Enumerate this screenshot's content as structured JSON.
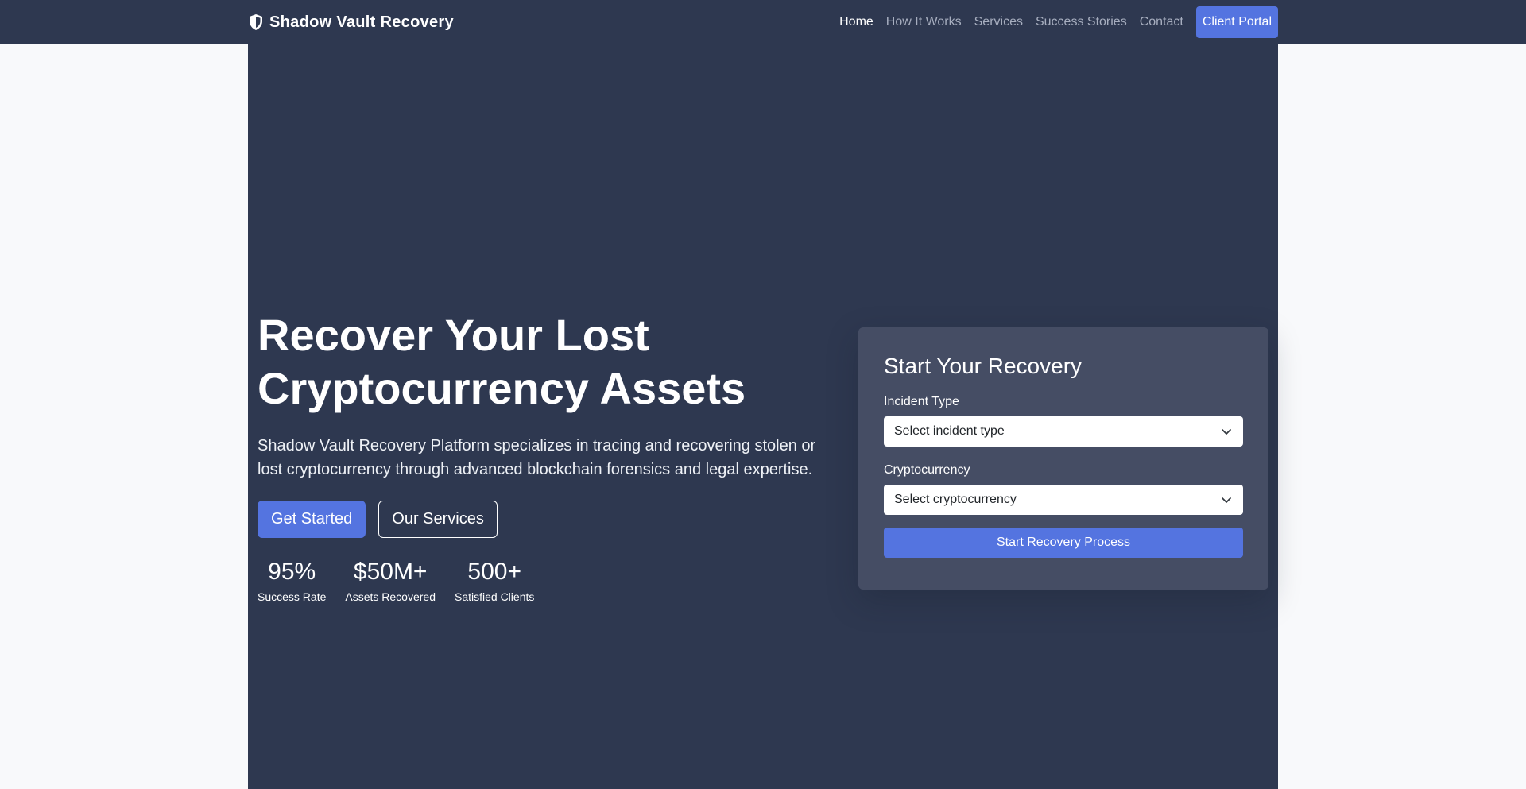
{
  "brand": {
    "name": "Shadow Vault Recovery",
    "icon": "shield-icon"
  },
  "nav": {
    "items": [
      {
        "label": "Home",
        "active": true
      },
      {
        "label": "How It Works"
      },
      {
        "label": "Services"
      },
      {
        "label": "Success Stories"
      },
      {
        "label": "Contact"
      }
    ],
    "portal_label": "Client Portal"
  },
  "hero": {
    "title": "Recover Your Lost Cryptocurrency Assets",
    "description": "Shadow Vault Recovery Platform specializes in tracing and recovering stolen or lost cryptocurrency through advanced blockchain forensics and legal expertise.",
    "primary_cta": "Get Started",
    "secondary_cta": "Our Services",
    "stats": [
      {
        "value": "95%",
        "label": "Success Rate"
      },
      {
        "value": "$50M+",
        "label": "Assets Recovered"
      },
      {
        "value": "500+",
        "label": "Satisfied Clients"
      }
    ]
  },
  "form": {
    "title": "Start Your Recovery",
    "incident_label": "Incident Type",
    "incident_value": "Select incident type",
    "crypto_label": "Cryptocurrency",
    "crypto_value": "Select cryptocurrency",
    "submit_label": "Start Recovery Process"
  },
  "colors": {
    "navbar_bg": "#2e3850",
    "hero_bg": "#2e3850",
    "accent": "#5474e0",
    "card_bg": "#454d64",
    "page_bg": "#f8f9fb"
  }
}
